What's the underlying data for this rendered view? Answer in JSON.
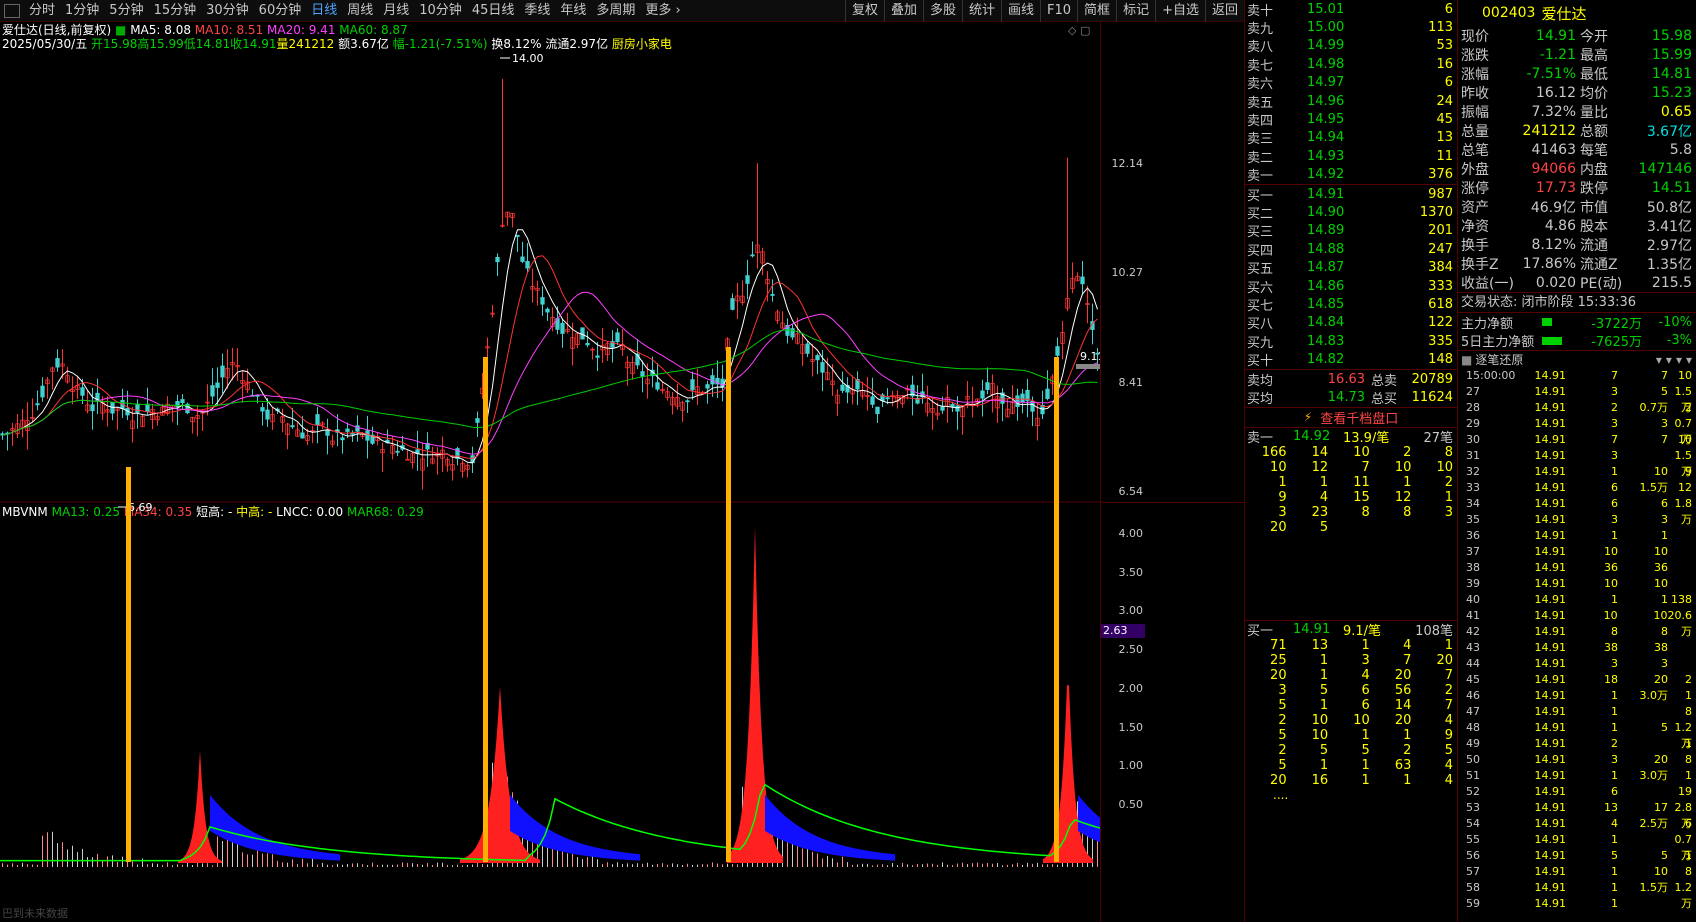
{
  "toolbar": {
    "periods": [
      "分时",
      "1分钟",
      "5分钟",
      "15分钟",
      "30分钟",
      "60分钟",
      "日线",
      "周线",
      "月线",
      "10分钟",
      "45日线",
      "季线",
      "年线",
      "多周期",
      "更多"
    ],
    "tools": [
      "复权",
      "叠加",
      "多股",
      "统计",
      "画线",
      "F10",
      "简框",
      "标记",
      "+自选",
      "返回"
    ]
  },
  "chart": {
    "title": "爱仕达(日线,前复权)",
    "ma5": "MA5: 8.08",
    "ma10": "MA10: 8.51",
    "ma20": "MA20: 9.41",
    "ma60": "MA60: 8.87",
    "date": "2025/05/30/五",
    "open": "开15.98",
    "high": "高15.99",
    "low": "低14.81",
    "close": "收14.91",
    "vol": "量241212",
    "amt": "额3.67亿",
    "chg": "幅-1.21(-7.51%)",
    "turn": "换8.12%",
    "float": "流通2.97亿",
    "sector": "厨房小家电",
    "peak_label": "14.00",
    "low_label": "6.69",
    "right_label": "9.11",
    "yticks": [
      "12.14",
      "10.27",
      "8.41",
      "6.54"
    ],
    "ind_name": "MBVNM",
    "ind_ma13": "MA13: 0.25",
    "ind_ma34": "MA34: 0.35",
    "ind_short": "短高: -",
    "ind_mid": "中高: -",
    "ind_lncc": "LNCC: 0.00",
    "ind_mar68": "MAR68: 0.29",
    "ind_yticks": [
      "4.00",
      "3.50",
      "3.00",
      "2.50",
      "2.00",
      "1.50",
      "1.00",
      "0.50"
    ],
    "ind_marker": "2.63",
    "watermark": "巴到未来数据"
  },
  "orderbook": {
    "asks": [
      {
        "label": "卖十",
        "price": "15.01",
        "vol": "6"
      },
      {
        "label": "卖九",
        "price": "15.00",
        "vol": "113"
      },
      {
        "label": "卖八",
        "price": "14.99",
        "vol": "53"
      },
      {
        "label": "卖七",
        "price": "14.98",
        "vol": "16"
      },
      {
        "label": "卖六",
        "price": "14.97",
        "vol": "6"
      },
      {
        "label": "卖五",
        "price": "14.96",
        "vol": "24"
      },
      {
        "label": "卖四",
        "price": "14.95",
        "vol": "45"
      },
      {
        "label": "卖三",
        "price": "14.94",
        "vol": "13"
      },
      {
        "label": "卖二",
        "price": "14.93",
        "vol": "11"
      },
      {
        "label": "卖一",
        "price": "14.92",
        "vol": "376"
      }
    ],
    "bids": [
      {
        "label": "买一",
        "price": "14.91",
        "vol": "987"
      },
      {
        "label": "买二",
        "price": "14.90",
        "vol": "1370"
      },
      {
        "label": "买三",
        "price": "14.89",
        "vol": "201"
      },
      {
        "label": "买四",
        "price": "14.88",
        "vol": "247"
      },
      {
        "label": "买五",
        "price": "14.87",
        "vol": "384"
      },
      {
        "label": "买六",
        "price": "14.86",
        "vol": "333"
      },
      {
        "label": "买七",
        "price": "14.85",
        "vol": "618"
      },
      {
        "label": "买八",
        "price": "14.84",
        "vol": "122"
      },
      {
        "label": "买九",
        "price": "14.83",
        "vol": "335"
      },
      {
        "label": "买十",
        "price": "14.82",
        "vol": "148"
      }
    ],
    "sell_avg": {
      "label": "卖均",
      "price": "16.63",
      "label2": "总卖",
      "vol": "20789"
    },
    "buy_avg": {
      "label": "买均",
      "price": "14.73",
      "label2": "总买",
      "vol": "11624"
    },
    "view_1000": "查看千档盘口",
    "sell1": {
      "label": "卖一",
      "price": "14.92",
      "per": "13.9/笔",
      "cnt": "27笔"
    },
    "sell1_orders": [
      "166",
      "14",
      "10",
      "2",
      "8",
      "10",
      "12",
      "7",
      "10",
      "10",
      "1",
      "1",
      "11",
      "1",
      "2",
      "9",
      "4",
      "15",
      "12",
      "1",
      "3",
      "23",
      "8",
      "8",
      "3",
      "20",
      "5"
    ],
    "buy1": {
      "label": "买一",
      "price": "14.91",
      "per": "9.1/笔",
      "cnt": "108笔"
    },
    "buy1_orders": [
      "71",
      "13",
      "1",
      "4",
      "1",
      "25",
      "1",
      "3",
      "7",
      "20",
      "20",
      "1",
      "4",
      "20",
      "7",
      "3",
      "5",
      "6",
      "56",
      "2",
      "5",
      "1",
      "6",
      "14",
      "7",
      "2",
      "10",
      "10",
      "20",
      "4",
      "5",
      "10",
      "1",
      "1",
      "9",
      "2",
      "5",
      "5",
      "2",
      "5",
      "5",
      "1",
      "1",
      "63",
      "4",
      "20",
      "16",
      "1",
      "1",
      "4"
    ],
    "buy1_more": "...."
  },
  "info": {
    "code": "002403",
    "name": "爱仕达",
    "rows": [
      {
        "k": "现价",
        "v": "14.91",
        "vc": "#00d000",
        "k2": "今开",
        "v2": "15.98",
        "v2c": "#00d000"
      },
      {
        "k": "涨跌",
        "v": "-1.21",
        "vc": "#00d000",
        "k2": "最高",
        "v2": "15.99",
        "v2c": "#00d000"
      },
      {
        "k": "涨幅",
        "v": "-7.51%",
        "vc": "#00d000",
        "k2": "最低",
        "v2": "14.81",
        "v2c": "#00d000"
      },
      {
        "k": "昨收",
        "v": "16.12",
        "vc": "#c8c8c8",
        "k2": "均价",
        "v2": "15.23",
        "v2c": "#00d000"
      },
      {
        "k": "振幅",
        "v": "7.32%",
        "vc": "#c8c8c8",
        "k2": "量比",
        "v2": "0.65",
        "v2c": "#ffff00"
      },
      {
        "k": "总量",
        "v": "241212",
        "vc": "#ffff00",
        "k2": "总额",
        "v2": "3.67亿",
        "v2c": "#00e0e0"
      },
      {
        "k": "总笔",
        "v": "41463",
        "vc": "#c8c8c8",
        "k2": "每笔",
        "v2": "5.8",
        "v2c": "#c8c8c8"
      },
      {
        "k": "外盘",
        "v": "94066",
        "vc": "#ff4444",
        "k2": "内盘",
        "v2": "147146",
        "v2c": "#00d000"
      },
      {
        "k": "涨停",
        "v": "17.73",
        "vc": "#ff4444",
        "k2": "跌停",
        "v2": "14.51",
        "v2c": "#00d000"
      },
      {
        "k": "资产",
        "v": "46.9亿",
        "vc": "#c8c8c8",
        "k2": "市值",
        "v2": "50.8亿",
        "v2c": "#c8c8c8"
      },
      {
        "k": "净资",
        "v": "4.86",
        "vc": "#c8c8c8",
        "k2": "股本",
        "v2": "3.41亿",
        "v2c": "#c8c8c8"
      },
      {
        "k": "换手",
        "v": "8.12%",
        "vc": "#c8c8c8",
        "k2": "流通",
        "v2": "2.97亿",
        "v2c": "#c8c8c8"
      },
      {
        "k": "换手Z",
        "v": "17.86%",
        "vc": "#c8c8c8",
        "k2": "流通Z",
        "v2": "1.35亿",
        "v2c": "#c8c8c8"
      },
      {
        "k": "收益(一)",
        "v": "0.020",
        "vc": "#c8c8c8",
        "k2": "PE(动)",
        "v2": "215.5",
        "v2c": "#c8c8c8"
      }
    ],
    "trade_status": "交易状态: 闭市阶段 15:33:36",
    "main_flow": {
      "label": "主力净额",
      "val": "-3722万",
      "pct": "-10%"
    },
    "main_flow5": {
      "label": "5日主力净额",
      "val": "-7625万",
      "pct": "-3%"
    },
    "ticks_title": "逐笔还原",
    "ticks": [
      {
        "t": "15:00:00",
        "p": "14.91",
        "n": "7",
        "n2": "7",
        "s": "10"
      },
      {
        "t": "27",
        "p": "14.91",
        "n": "3",
        "n2": "5",
        "s": "1.5万"
      },
      {
        "t": "28",
        "p": "14.91",
        "n": "2",
        "n2": "0.7万",
        "s": "2"
      },
      {
        "t": "29",
        "p": "14.91",
        "n": "3",
        "n2": "3",
        "s": "0.7万"
      },
      {
        "t": "30",
        "p": "14.91",
        "n": "7",
        "n2": "7",
        "s": "10"
      },
      {
        "t": "31",
        "p": "14.91",
        "n": "3",
        "n2": "",
        "s": "1.5万"
      },
      {
        "t": "32",
        "p": "14.91",
        "n": "1",
        "n2": "10",
        "s": "9"
      },
      {
        "t": "33",
        "p": "14.91",
        "n": "6",
        "n2": "1.5万",
        "s": "12"
      },
      {
        "t": "34",
        "p": "14.91",
        "n": "6",
        "n2": "6",
        "s": "1.8万"
      },
      {
        "t": "35",
        "p": "14.91",
        "n": "3",
        "n2": "3",
        "s": ""
      },
      {
        "t": "36",
        "p": "14.91",
        "n": "1",
        "n2": "1",
        "s": ""
      },
      {
        "t": "37",
        "p": "14.91",
        "n": "10",
        "n2": "10",
        "s": ""
      },
      {
        "t": "38",
        "p": "14.91",
        "n": "36",
        "n2": "36",
        "s": ""
      },
      {
        "t": "39",
        "p": "14.91",
        "n": "10",
        "n2": "10",
        "s": ""
      },
      {
        "t": "40",
        "p": "14.91",
        "n": "1",
        "n2": "1",
        "s": "138"
      },
      {
        "t": "41",
        "p": "14.91",
        "n": "10",
        "n2": "10",
        "s": "20.6万"
      },
      {
        "t": "42",
        "p": "14.91",
        "n": "8",
        "n2": "8",
        "s": ""
      },
      {
        "t": "43",
        "p": "14.91",
        "n": "38",
        "n2": "38",
        "s": ""
      },
      {
        "t": "44",
        "p": "14.91",
        "n": "3",
        "n2": "3",
        "s": ""
      },
      {
        "t": "45",
        "p": "14.91",
        "n": "18",
        "n2": "20",
        "s": "2"
      },
      {
        "t": "46",
        "p": "14.91",
        "n": "1",
        "n2": "3.0万",
        "s": "1"
      },
      {
        "t": "47",
        "p": "14.91",
        "n": "1",
        "n2": "",
        "s": "8"
      },
      {
        "t": "48",
        "p": "14.91",
        "n": "1",
        "n2": "5",
        "s": "1.2万"
      },
      {
        "t": "49",
        "p": "14.91",
        "n": "2",
        "n2": "",
        "s": "1"
      },
      {
        "t": "50",
        "p": "14.91",
        "n": "3",
        "n2": "20",
        "s": "8"
      },
      {
        "t": "51",
        "p": "14.91",
        "n": "1",
        "n2": "3.0万",
        "s": "1"
      },
      {
        "t": "52",
        "p": "14.91",
        "n": "6",
        "n2": "",
        "s": "19"
      },
      {
        "t": "53",
        "p": "14.91",
        "n": "13",
        "n2": "17",
        "s": "2.8万"
      },
      {
        "t": "54",
        "p": "14.91",
        "n": "4",
        "n2": "2.5万",
        "s": "6"
      },
      {
        "t": "55",
        "p": "14.91",
        "n": "1",
        "n2": "",
        "s": "0.7万"
      },
      {
        "t": "56",
        "p": "14.91",
        "n": "5",
        "n2": "5",
        "s": "1"
      },
      {
        "t": "57",
        "p": "14.91",
        "n": "1",
        "n2": "10",
        "s": "8"
      },
      {
        "t": "58",
        "p": "14.91",
        "n": "1",
        "n2": "1.5万",
        "s": "1.2万"
      },
      {
        "t": "59",
        "p": "14.91",
        "n": "1",
        "n2": "",
        "s": ""
      }
    ]
  },
  "colors": {
    "up": "#ff4444",
    "down": "#00d000",
    "ma5": "#ffffff",
    "ma10": "#ff3333",
    "ma20": "#ff40ff",
    "ma60": "#00cc00",
    "signal": "#ffb000",
    "blue": "#0000ff"
  }
}
